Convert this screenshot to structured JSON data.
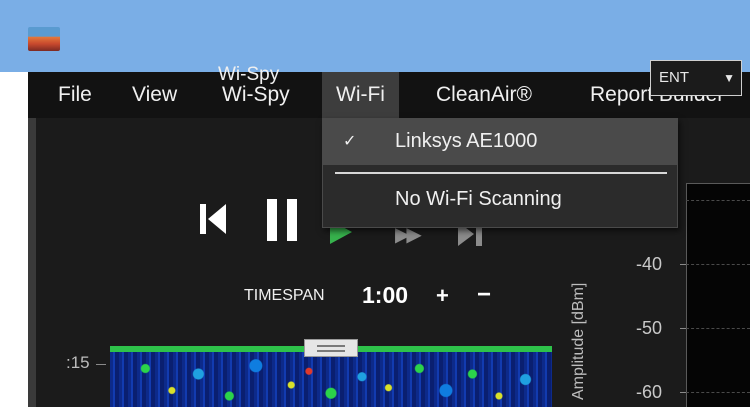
{
  "menubar": {
    "items": [
      {
        "label": "File"
      },
      {
        "label": "View"
      },
      {
        "label": "Wi-Spy"
      },
      {
        "label": "Wi-Fi"
      },
      {
        "label": "CleanAir®"
      },
      {
        "label": "Report Builder"
      }
    ],
    "active": "Wi-Fi"
  },
  "device_label": "Wi-Spy",
  "mode_select": {
    "value": "ENT"
  },
  "wifi_menu": {
    "items": [
      {
        "label": "Linksys AE1000",
        "checked": true
      },
      {
        "label": "No Wi-Fi Scanning",
        "checked": false
      }
    ],
    "check_glyph": "✓"
  },
  "timespan": {
    "label": "TIMESPAN",
    "value": "1:00",
    "plus": "+",
    "minus": "−"
  },
  "waterfall": {
    "time_tick": ":15"
  },
  "spectrum": {
    "axis_label": "Amplitude [dBm]",
    "y_ticks": [
      "-40",
      "-50",
      "-60"
    ]
  },
  "colors": {
    "titlebar": "#7aaee6",
    "play": "#37b24d",
    "menu_bg": "#121212"
  },
  "icons": {
    "app": "app-logo-icon",
    "skip_back": "skip-back-icon",
    "pause": "pause-icon",
    "play": "play-icon",
    "fast_forward": "fast-forward-icon",
    "skip_forward": "skip-forward-icon"
  }
}
